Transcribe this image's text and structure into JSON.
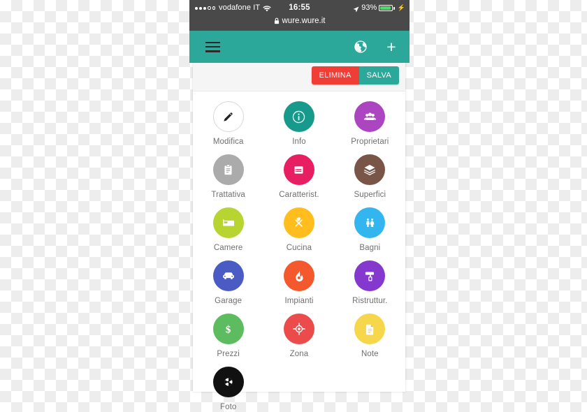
{
  "status_bar": {
    "carrier": "vodafone IT",
    "signal_dots_filled": 3,
    "signal_dots_total": 5,
    "wifi_icon": "wifi-icon",
    "time": "16:55",
    "location_icon": "location-arrow-icon",
    "battery_percent": "93%",
    "battery_level": 93,
    "battery_charging_icon": "bolt-icon",
    "lock_icon": "lock-icon",
    "url": "wure.wure.it",
    "bar_color": "#494949"
  },
  "appbar": {
    "menu_icon": "hamburger-menu-icon",
    "globe_icon": "globe-icon",
    "add_icon": "plus-icon",
    "background_color": "#2CA89B"
  },
  "actionbar": {
    "delete_label": "ELIMINA",
    "save_label": "SALVA",
    "delete_color": "#EF3E36",
    "save_color": "#2CA89B"
  },
  "grid": {
    "items": [
      {
        "label": "Modifica",
        "icon": "pencil-icon",
        "color": "#FFFFFF",
        "style": "outline"
      },
      {
        "label": "Info",
        "icon": "info-icon",
        "color": "#17998C",
        "style": "filled"
      },
      {
        "label": "Proprietari",
        "icon": "people-icon",
        "color": "#AC46C0",
        "style": "filled"
      },
      {
        "label": "Trattativa",
        "icon": "clipboard-icon",
        "color": "#ABABAB",
        "style": "filled"
      },
      {
        "label": "Caratterist.",
        "icon": "list-icon",
        "color": "#E81E63",
        "style": "filled"
      },
      {
        "label": "Superfici",
        "icon": "layers-icon",
        "color": "#795548",
        "style": "filled"
      },
      {
        "label": "Camere",
        "icon": "bed-icon",
        "color": "#B8D430",
        "style": "filled"
      },
      {
        "label": "Cucina",
        "icon": "cutlery-icon",
        "color": "#FFBE1E",
        "style": "filled"
      },
      {
        "label": "Bagni",
        "icon": "restroom-icon",
        "color": "#33B5F0",
        "style": "filled"
      },
      {
        "label": "Garage",
        "icon": "car-icon",
        "color": "#4A5CC4",
        "style": "filled"
      },
      {
        "label": "Impianti",
        "icon": "flame-icon",
        "color": "#F4582D",
        "style": "filled"
      },
      {
        "label": "Ristruttur.",
        "icon": "paint-roller-icon",
        "color": "#8438CE",
        "style": "filled"
      },
      {
        "label": "Prezzi",
        "icon": "dollar-icon",
        "color": "#5CBC5F",
        "style": "filled"
      },
      {
        "label": "Zona",
        "icon": "target-icon",
        "color": "#EB4B4B",
        "style": "filled"
      },
      {
        "label": "Note",
        "icon": "document-icon",
        "color": "#F6D64A",
        "style": "filled"
      },
      {
        "label": "Foto",
        "icon": "camera-aperture-icon",
        "color": "#111111",
        "style": "filled"
      }
    ]
  }
}
